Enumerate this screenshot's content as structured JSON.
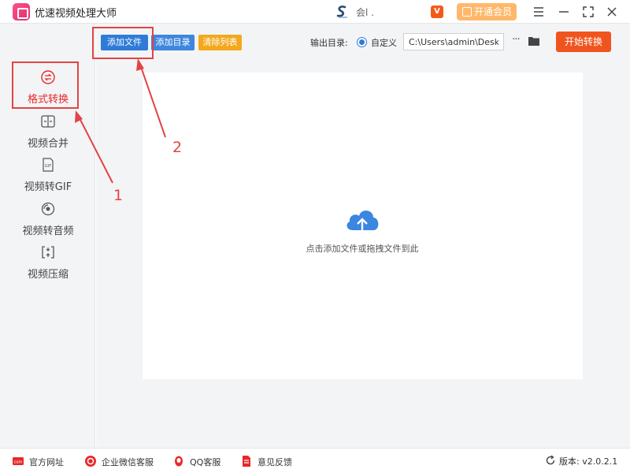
{
  "app": {
    "title": "优速视频处理大师",
    "user_name": "会l ."
  },
  "titlebar": {
    "vip_label": "开通会员"
  },
  "sidebar": {
    "items": [
      {
        "label": "格式转换",
        "icon": "format-convert-icon",
        "active": true
      },
      {
        "label": "视频合并",
        "icon": "video-merge-icon"
      },
      {
        "label": "视频转GIF",
        "icon": "gif-icon"
      },
      {
        "label": "视频转音频",
        "icon": "audio-icon"
      },
      {
        "label": "视频压缩",
        "icon": "compress-icon"
      }
    ]
  },
  "toolbar": {
    "add_file": "添加文件",
    "add_dir": "添加目录",
    "clear_list": "清除列表",
    "output_label": "输出目录:",
    "custom_label": "自定义",
    "output_path": "C:\\Users\\admin\\Deskto",
    "more": "···",
    "start": "开始转换"
  },
  "main": {
    "drop_hint": "点击添加文件或拖拽文件到此"
  },
  "annotations": {
    "step1": "1",
    "step2": "2"
  },
  "footer": {
    "links": [
      "官方网址",
      "企业微信客服",
      "QQ客服",
      "意见反馈"
    ],
    "version": "版本: v2.0.2.1"
  },
  "colors": {
    "primary": "#2f7bd8",
    "accent_orange": "#f0541e",
    "clear_orange": "#f3a81d",
    "highlight_red": "#e14444",
    "vip": "#ffb86b"
  }
}
